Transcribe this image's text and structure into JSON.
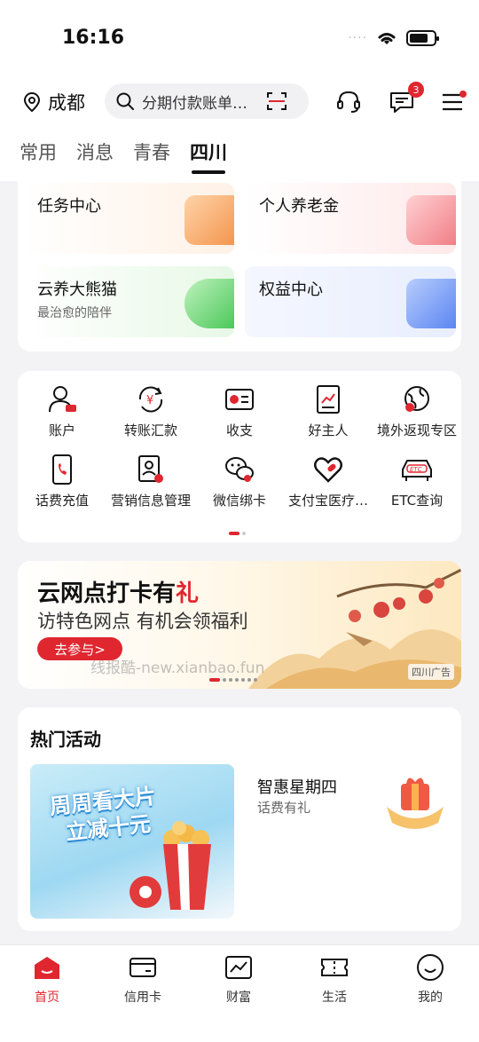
{
  "status_bar": {
    "time": "16:16",
    "signal_dots": "····"
  },
  "header": {
    "city": "成都",
    "search_text": "分期付款账单…",
    "message_badge": "3"
  },
  "tabs": [
    {
      "label": "常用"
    },
    {
      "label": "消息"
    },
    {
      "label": "青春"
    },
    {
      "label": "四川"
    }
  ],
  "quick_cards": [
    {
      "title": "任务中心",
      "subtitle": ""
    },
    {
      "title": "个人养老金",
      "subtitle": ""
    },
    {
      "title": "云养大熊猫",
      "subtitle": "最治愈的陪伴"
    },
    {
      "title": "权益中心",
      "subtitle": ""
    }
  ],
  "grid": [
    {
      "label": "账户",
      "icon": "user-card-icon"
    },
    {
      "label": "转账汇款",
      "icon": "transfer-icon"
    },
    {
      "label": "收支",
      "icon": "chart-card-icon"
    },
    {
      "label": "好主人",
      "icon": "trend-doc-icon"
    },
    {
      "label": "境外返现专区",
      "icon": "globe-icon"
    },
    {
      "label": "话费充值",
      "icon": "phone-icon"
    },
    {
      "label": "营销信息管理",
      "icon": "doc-gear-icon"
    },
    {
      "label": "微信绑卡",
      "icon": "wechat-icon"
    },
    {
      "label": "支付宝医疗…",
      "icon": "heart-pill-icon"
    },
    {
      "label": "ETC查询",
      "icon": "etc-car-icon"
    }
  ],
  "banner": {
    "title_prefix": "云网点打卡有",
    "title_highlight": "礼",
    "subtitle": "访特色网点 有机会领福利",
    "button": "去参与>",
    "watermark": "线报酷-new.xianbao.fun",
    "ad_tag": "四川广告"
  },
  "hot": {
    "title": "热门活动",
    "image_text_1": "周周看大片",
    "image_text_2": "立减十元",
    "item_title": "智惠星期四",
    "item_subtitle": "话费有礼"
  },
  "tabbar": [
    {
      "label": "首页",
      "icon": "home-icon"
    },
    {
      "label": "信用卡",
      "icon": "credit-card-icon"
    },
    {
      "label": "财富",
      "icon": "wealth-chart-icon"
    },
    {
      "label": "生活",
      "icon": "ticket-icon"
    },
    {
      "label": "我的",
      "icon": "smile-icon"
    }
  ],
  "colors": {
    "accent": "#e0262f",
    "background": "#f3f3f6"
  }
}
